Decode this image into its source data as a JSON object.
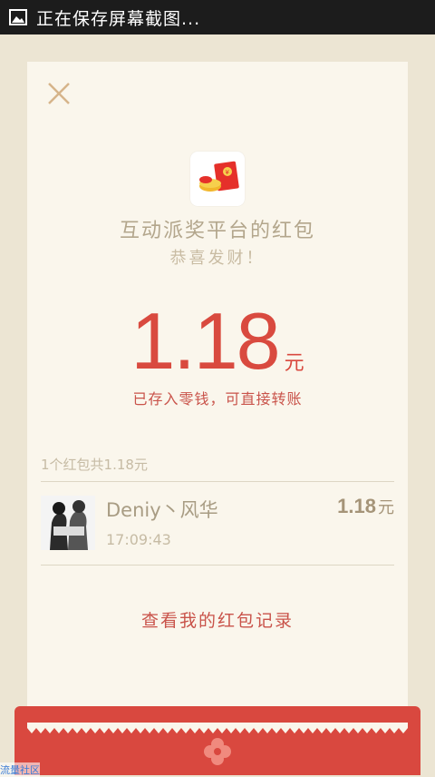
{
  "status_bar": {
    "icon": "image-icon",
    "text": "正在保存屏幕截图..."
  },
  "card": {
    "close_icon": "close-icon",
    "app_icon": "red-envelope-icon",
    "sender_title": "互动派奖平台的红包",
    "greeting": "恭喜发财！",
    "amount": "1.18",
    "amount_unit": "元",
    "saved_note": "已存入零钱，可直接转账"
  },
  "records": {
    "summary": "1个红包共1.18元",
    "items": [
      {
        "name": "Deniy丶风华",
        "time": "17:09:43",
        "amount": "1.18",
        "unit": "元"
      }
    ]
  },
  "history_link": "查看我的红包记录",
  "watermark": "流量社区",
  "colors": {
    "accent_red": "#d94a3f",
    "card_bg": "#faf6ec",
    "page_bg": "#ece5d3"
  }
}
